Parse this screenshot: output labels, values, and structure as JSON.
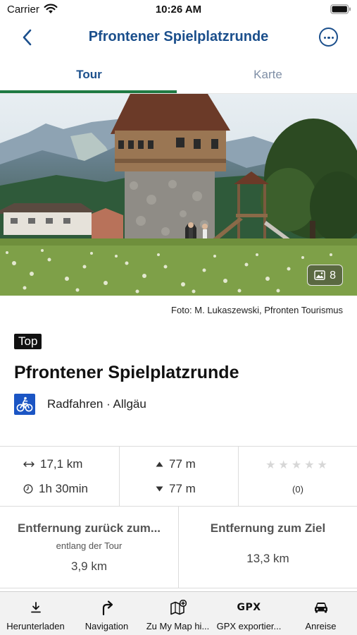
{
  "status_bar": {
    "carrier": "Carrier",
    "time": "10:26 AM"
  },
  "nav": {
    "title": "Pfrontener Spielplatzrunde",
    "back_icon": "chevron-left-icon",
    "more_icon": "ellipsis-circle-icon"
  },
  "tabs": [
    {
      "label": "Tour",
      "selected": true
    },
    {
      "label": "Karte",
      "selected": false
    }
  ],
  "hero": {
    "photo_count": "8"
  },
  "photo_credit": "Foto: M. Lukaszewski, Pfronten Tourismus",
  "tour": {
    "badge": "Top",
    "title": "Pfrontener Spielplatzrunde",
    "category": "Radfahren · Allgäu",
    "category_icon": "bicycle-icon"
  },
  "stats": {
    "distance": "17,1 km",
    "duration": "1h 30min",
    "ascent": "77 m",
    "descent": "77 m",
    "rating_stars": 0,
    "rating_count": "(0)"
  },
  "distances": {
    "back_label": "Entfernung zurück zum...",
    "back_sub": "entlang der Tour",
    "back_value": "3,9 km",
    "goal_label": "Entfernung zum Ziel",
    "goal_value": "13,3 km"
  },
  "toolbar": [
    {
      "label": "Herunterladen",
      "icon": "download-icon"
    },
    {
      "label": "Navigation",
      "icon": "turn-right-arrow-icon"
    },
    {
      "label": "Zu My Map hi...",
      "icon": "map-add-icon"
    },
    {
      "label": "GPX exportier...",
      "icon": "gpx-icon",
      "glyph": "GPX"
    },
    {
      "label": "Anreise",
      "icon": "car-icon"
    }
  ],
  "colors": {
    "accent": "#1b4f8c",
    "tab_indicator": "#1f7a43",
    "category_bg": "#1b55c4"
  }
}
